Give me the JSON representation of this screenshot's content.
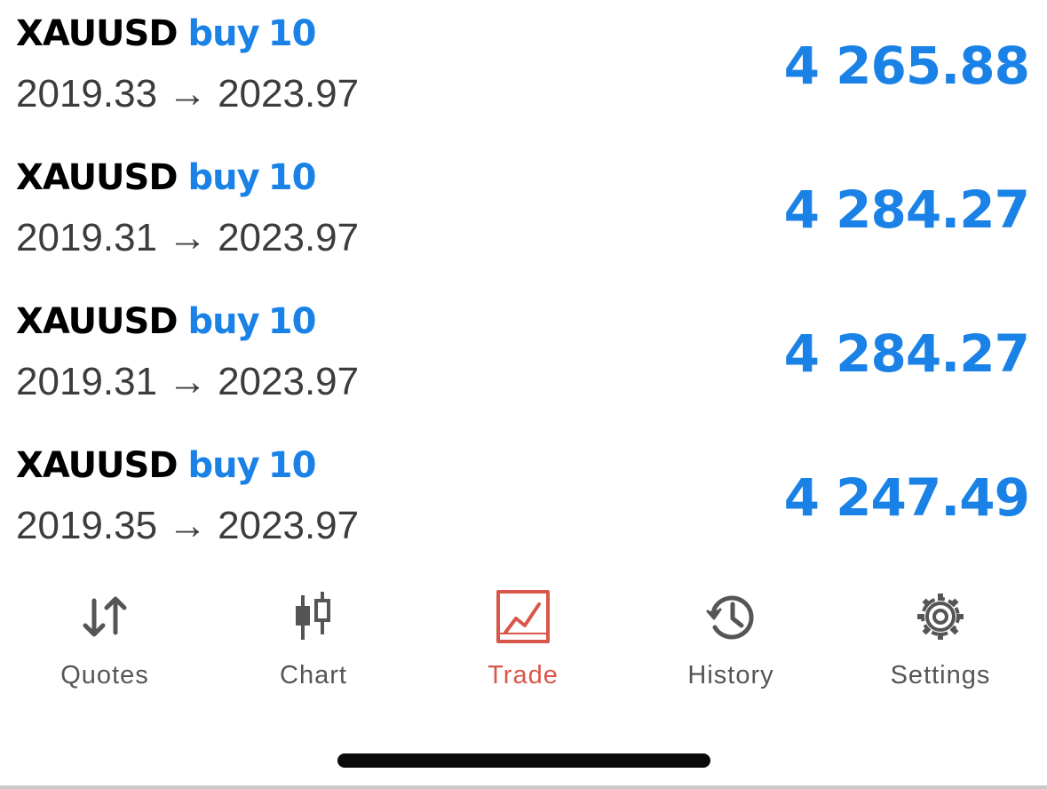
{
  "positions": [
    {
      "symbol": "XAUUSD",
      "side": "buy",
      "volume": "10",
      "open_price": "2019.33",
      "arrow": "→",
      "current_price": "2023.97",
      "profit": "4 265.88"
    },
    {
      "symbol": "XAUUSD",
      "side": "buy",
      "volume": "10",
      "open_price": "2019.31",
      "arrow": "→",
      "current_price": "2023.97",
      "profit": "4 284.27"
    },
    {
      "symbol": "XAUUSD",
      "side": "buy",
      "volume": "10",
      "open_price": "2019.31",
      "arrow": "→",
      "current_price": "2023.97",
      "profit": "4 284.27"
    },
    {
      "symbol": "XAUUSD",
      "side": "buy",
      "volume": "10",
      "open_price": "2019.35",
      "arrow": "→",
      "current_price": "2023.97",
      "profit": "4 247.49"
    }
  ],
  "tabbar": {
    "active": "trade",
    "tabs": [
      {
        "id": "quotes",
        "label": "Quotes",
        "icon": "quotes-arrows-icon"
      },
      {
        "id": "chart",
        "label": "Chart",
        "icon": "candlestick-chart-icon"
      },
      {
        "id": "trade",
        "label": "Trade",
        "icon": "trade-chart-icon"
      },
      {
        "id": "history",
        "label": "History",
        "icon": "history-clock-icon"
      },
      {
        "id": "settings",
        "label": "Settings",
        "icon": "gear-icon"
      }
    ]
  },
  "colors": {
    "accent_blue": "#1a82e6",
    "active_tab": "#d9574a",
    "inactive_tab": "#555555",
    "text_primary": "#000000",
    "text_secondary": "#3c3c3c"
  }
}
